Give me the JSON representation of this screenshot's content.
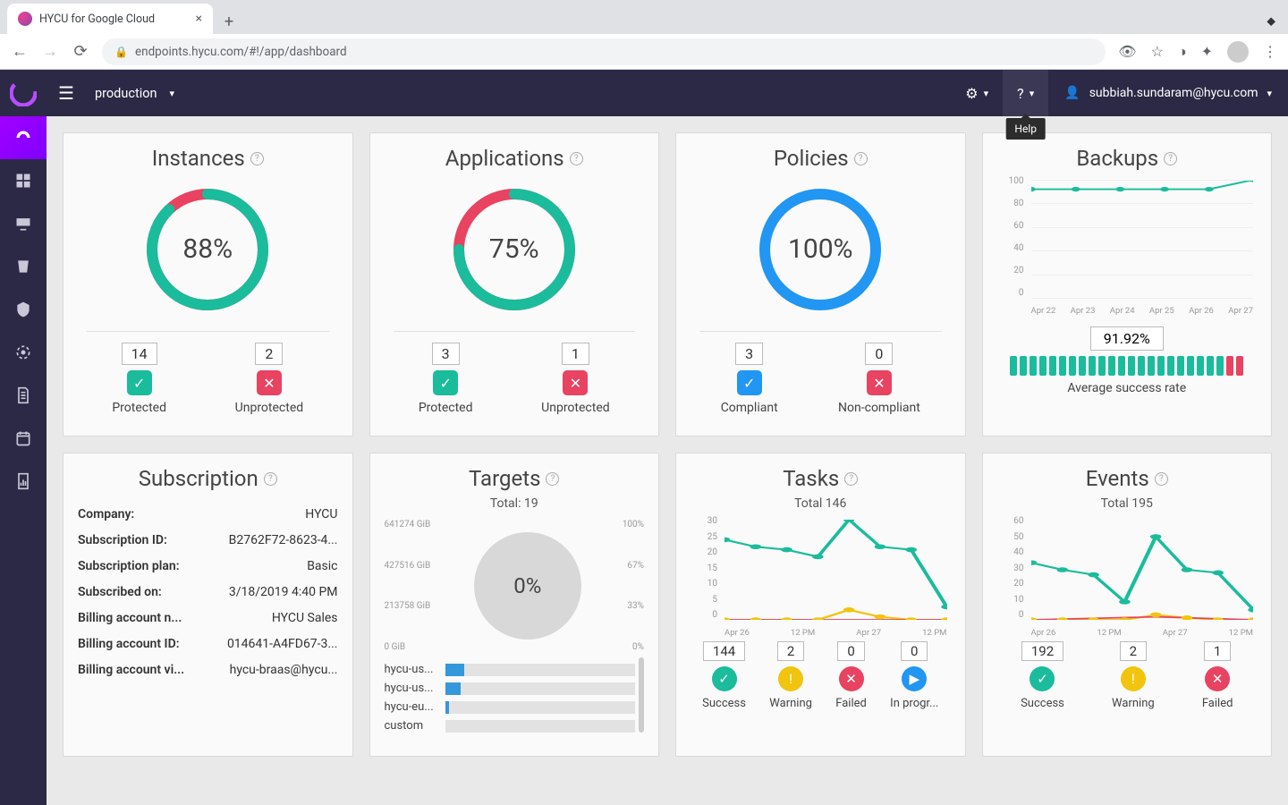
{
  "browser": {
    "tab_title": "HYCU for Google Cloud",
    "url": "endpoints.hycu.com/#!/app/dashboard"
  },
  "header": {
    "environment": "production",
    "help_tooltip": "Help",
    "user_email": "subbiah.sundaram@hycu.com"
  },
  "cards": {
    "instances": {
      "title": "Instances",
      "percent": "88%",
      "pct_val": 88,
      "protected_count": "14",
      "unprotected_count": "2",
      "protected_label": "Protected",
      "unprotected_label": "Unprotected"
    },
    "applications": {
      "title": "Applications",
      "percent": "75%",
      "pct_val": 75,
      "protected_count": "3",
      "unprotected_count": "1",
      "protected_label": "Protected",
      "unprotected_label": "Unprotected"
    },
    "policies": {
      "title": "Policies",
      "percent": "100%",
      "pct_val": 100,
      "compliant_count": "3",
      "noncompliant_count": "0",
      "compliant_label": "Compliant",
      "noncompliant_label": "Non-compliant"
    },
    "backups": {
      "title": "Backups",
      "rate": "91.92%",
      "caption": "Average success rate",
      "y_ticks": [
        "100",
        "80",
        "60",
        "40",
        "20",
        "0"
      ],
      "x_ticks": [
        "Apr 22",
        "Apr 23",
        "Apr 24",
        "Apr 25",
        "Apr 26",
        "Apr 27"
      ]
    },
    "subscription": {
      "title": "Subscription",
      "rows": [
        {
          "k": "Company:",
          "v": "HYCU"
        },
        {
          "k": "Subscription ID:",
          "v": "B2762F72-8623-4..."
        },
        {
          "k": "Subscription plan:",
          "v": "Basic"
        },
        {
          "k": "Subscribed on:",
          "v": "3/18/2019 4:40 PM"
        },
        {
          "k": "Billing account n...",
          "v": "HYCU Sales"
        },
        {
          "k": "Billing account ID:",
          "v": "014641-A4FD67-3..."
        },
        {
          "k": "Billing account vi...",
          "v": "hycu-braas@hycu..."
        }
      ]
    },
    "targets": {
      "title": "Targets",
      "total": "Total: 19",
      "percent": "0%",
      "left_ticks": [
        "641274 GiB",
        "427516 GiB",
        "213758 GiB",
        "0 GiB"
      ],
      "right_ticks": [
        "100%",
        "67%",
        "33%",
        "0%"
      ],
      "rows": [
        {
          "name": "hycu-us...",
          "fill": 10
        },
        {
          "name": "hycu-us...",
          "fill": 8
        },
        {
          "name": "hycu-eu...",
          "fill": 2
        },
        {
          "name": "custom",
          "fill": 0
        }
      ]
    },
    "tasks": {
      "title": "Tasks",
      "total": "Total 146",
      "y_ticks": [
        "30",
        "25",
        "20",
        "15",
        "10",
        "5",
        "0"
      ],
      "x_ticks": [
        "Apr 26",
        "12 PM",
        "Apr 27",
        "12 PM"
      ],
      "stats": [
        {
          "count": "144",
          "label": "Success",
          "color": "green",
          "icon": "✓"
        },
        {
          "count": "2",
          "label": "Warning",
          "color": "orange",
          "icon": "!"
        },
        {
          "count": "0",
          "label": "Failed",
          "color": "red",
          "icon": "✕"
        },
        {
          "count": "0",
          "label": "In progr...",
          "color": "blue",
          "icon": "▶"
        }
      ]
    },
    "events": {
      "title": "Events",
      "total": "Total 195",
      "y_ticks": [
        "60",
        "50",
        "40",
        "30",
        "20",
        "10",
        "0"
      ],
      "x_ticks": [
        "Apr 26",
        "12 PM",
        "Apr 27",
        "12 PM"
      ],
      "stats": [
        {
          "count": "192",
          "label": "Success",
          "color": "green",
          "icon": "✓"
        },
        {
          "count": "2",
          "label": "Warning",
          "color": "orange",
          "icon": "!"
        },
        {
          "count": "1",
          "label": "Failed",
          "color": "red",
          "icon": "✕"
        }
      ]
    }
  },
  "chart_data": [
    {
      "type": "pie",
      "card": "instances",
      "series": [
        {
          "name": "Protected",
          "value": 14
        },
        {
          "name": "Unprotected",
          "value": 2
        }
      ],
      "title": "Instances",
      "percent": 88
    },
    {
      "type": "pie",
      "card": "applications",
      "series": [
        {
          "name": "Protected",
          "value": 3
        },
        {
          "name": "Unprotected",
          "value": 1
        }
      ],
      "title": "Applications",
      "percent": 75
    },
    {
      "type": "pie",
      "card": "policies",
      "series": [
        {
          "name": "Compliant",
          "value": 3
        },
        {
          "name": "Non-compliant",
          "value": 0
        }
      ],
      "title": "Policies",
      "percent": 100
    },
    {
      "type": "line",
      "card": "backups",
      "title": "Backups",
      "x": [
        "Apr 22",
        "Apr 23",
        "Apr 24",
        "Apr 25",
        "Apr 26",
        "Apr 27"
      ],
      "series": [
        {
          "name": "Success %",
          "values": [
            92,
            92,
            92,
            92,
            92,
            100
          ]
        }
      ],
      "ylim": [
        0,
        100
      ],
      "average_success_rate": 91.92
    },
    {
      "type": "line",
      "card": "tasks",
      "title": "Tasks",
      "x": [
        "Apr 26 00",
        "Apr 26 06",
        "Apr 26 12",
        "Apr 26 18",
        "Apr 27 00",
        "Apr 27 06",
        "Apr 27 12",
        "Apr 27 18"
      ],
      "series": [
        {
          "name": "Success",
          "values": [
            24,
            22,
            21,
            19,
            30,
            22,
            21,
            4
          ]
        },
        {
          "name": "Warning",
          "values": [
            0,
            0,
            0,
            0,
            3,
            1,
            0,
            0
          ]
        },
        {
          "name": "Failed",
          "values": [
            0,
            0,
            0,
            0,
            0,
            0,
            0,
            0
          ]
        }
      ],
      "ylim": [
        0,
        30
      ],
      "total": 146
    },
    {
      "type": "line",
      "card": "events",
      "title": "Events",
      "x": [
        "Apr 26 00",
        "Apr 26 06",
        "Apr 26 12",
        "Apr 26 18",
        "Apr 27 00",
        "Apr 27 06",
        "Apr 27 12",
        "Apr 27 18"
      ],
      "series": [
        {
          "name": "Success",
          "values": [
            34,
            30,
            27,
            11,
            50,
            30,
            28,
            6
          ]
        },
        {
          "name": "Warning",
          "values": [
            0,
            0,
            0,
            0,
            3,
            1,
            0,
            0
          ]
        },
        {
          "name": "Failed",
          "values": [
            0,
            0,
            0,
            0,
            1,
            0,
            0,
            0
          ]
        }
      ],
      "ylim": [
        0,
        60
      ],
      "total": 195
    },
    {
      "type": "bar",
      "card": "targets",
      "title": "Targets",
      "categories": [
        "hycu-us...",
        "hycu-us...",
        "hycu-eu...",
        "custom"
      ],
      "values_pct": [
        10,
        8,
        2,
        0
      ],
      "total_count": 19,
      "capacity_gib": 641274,
      "used_pct": 0
    }
  ]
}
